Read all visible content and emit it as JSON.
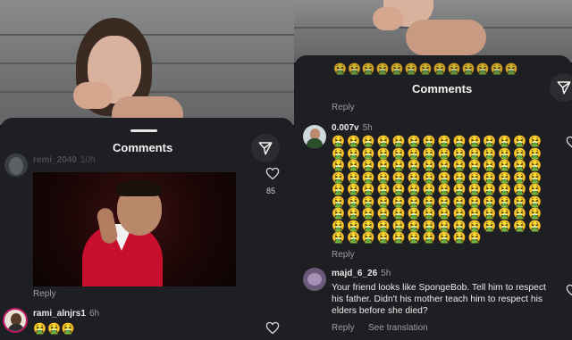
{
  "left": {
    "sheet_title": "Comments",
    "comment1": {
      "username": "remi_2040",
      "time": "10h",
      "likes": "85"
    },
    "reply_label": "Reply",
    "comment2": {
      "username": "rami_alnjrs1",
      "time": "6h",
      "emoji": "🤮🤮🤮"
    }
  },
  "right": {
    "sheet_title": "Comments",
    "reply_label_top": "Reply",
    "comment1": {
      "username": "0.007v",
      "time": "5h",
      "emoji_grid": "🤮"
    },
    "reply_label_mid": "Reply",
    "comment2": {
      "username": "majd_6_26",
      "time": "5h",
      "text": "Your friend looks like SpongeBob. Tell him to respect his father. Didn't his mother teach him to respect his elders before she died?",
      "reply_label": "Reply",
      "see_translation": "See translation"
    }
  },
  "icons": {
    "send": "send-icon",
    "heart": "heart-outline-icon"
  },
  "colors": {
    "sheet_bg": "#1d1f22",
    "page_bg": "#111316",
    "accent_red": "#c8102e"
  }
}
